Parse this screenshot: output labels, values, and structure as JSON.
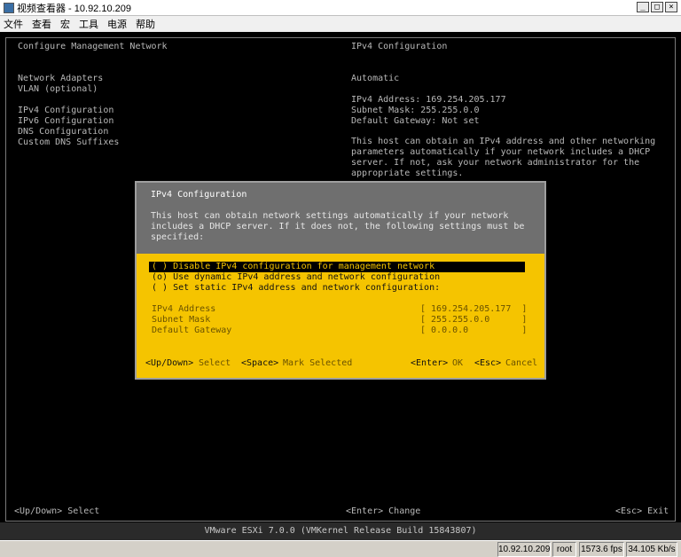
{
  "window": {
    "title": "视频查看器 - 10.92.10.209",
    "minimize": "_",
    "maximize": "□",
    "close": "×"
  },
  "menu": [
    "文件",
    "查看",
    "宏",
    "工具",
    "电源",
    "帮助"
  ],
  "console": {
    "left_header": "Configure Management Network",
    "right_header": "IPv4 Configuration",
    "left_items": [
      "Network Adapters",
      "VLAN (optional)",
      "IPv4 Configuration",
      "IPv6 Configuration",
      "DNS Configuration",
      "Custom DNS Suffixes"
    ],
    "right_mode": "Automatic",
    "right_ipv4_address": "IPv4 Address: 169.254.205.177",
    "right_subnet_mask": "Subnet Mask: 255.255.0.0",
    "right_default_gateway": "Default Gateway: Not set",
    "right_desc_lines": [
      "This host can obtain an IPv4 address and other networking",
      "parameters automatically if your network includes a DHCP",
      "server. If not, ask your network administrator for the",
      "appropriate settings."
    ],
    "hint_left": "<Up/Down> Select",
    "hint_center": "<Enter> Change",
    "hint_right": "<Esc> Exit",
    "footer": "VMware ESXi 7.0.0 (VMKernel Release Build 15843807)"
  },
  "dialog": {
    "title": "IPv4 Configuration",
    "desc_lines": [
      "This host can obtain network settings automatically if your network",
      "includes a DHCP server. If it does not, the following settings must be",
      "specified:"
    ],
    "options": [
      "( ) Disable IPv4 configuration for management network",
      "(o) Use dynamic IPv4 address and network configuration",
      "( ) Set static IPv4 address and network configuration:"
    ],
    "fields": [
      {
        "label": "IPv4 Address",
        "value": "[ 169.254.205.177  ]"
      },
      {
        "label": "Subnet Mask",
        "value": "[ 255.255.0.0      ]"
      },
      {
        "label": "Default Gateway",
        "value": "[ 0.0.0.0          ]"
      }
    ],
    "key_updown": "<Up/Down>",
    "act_select": "Select",
    "key_space": "<Space>",
    "act_mark": "Mark Selected",
    "key_enter": "<Enter>",
    "act_ok": "OK",
    "key_esc": "<Esc>",
    "act_cancel": "Cancel"
  },
  "statusbar": {
    "host": "10.92.10.209",
    "user": "root",
    "fps": "1573.6 fps",
    "rate": "34.105 Kb/s"
  },
  "colors": {
    "dialog_yellow": "#f5c400",
    "dialog_gray": "#6f6f6f",
    "console_text": "#b8b8b8"
  }
}
